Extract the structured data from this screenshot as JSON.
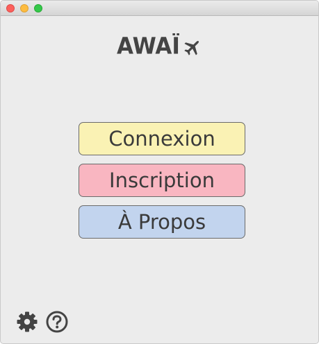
{
  "window": {
    "controls": [
      "close",
      "minimize",
      "maximize"
    ]
  },
  "logo": {
    "text": "AWAÏ",
    "icon": "airplane-icon"
  },
  "menu": {
    "connexion_label": "Connexion",
    "inscription_label": "Inscription",
    "apropos_label": "À Propos"
  },
  "footer": {
    "settings_icon": "gear-icon",
    "help_icon": "help-icon"
  },
  "colors": {
    "connexion": "#faf2b4",
    "inscription": "#f9b6c1",
    "apropos": "#c2d4ee",
    "text": "#3a3a3a"
  }
}
